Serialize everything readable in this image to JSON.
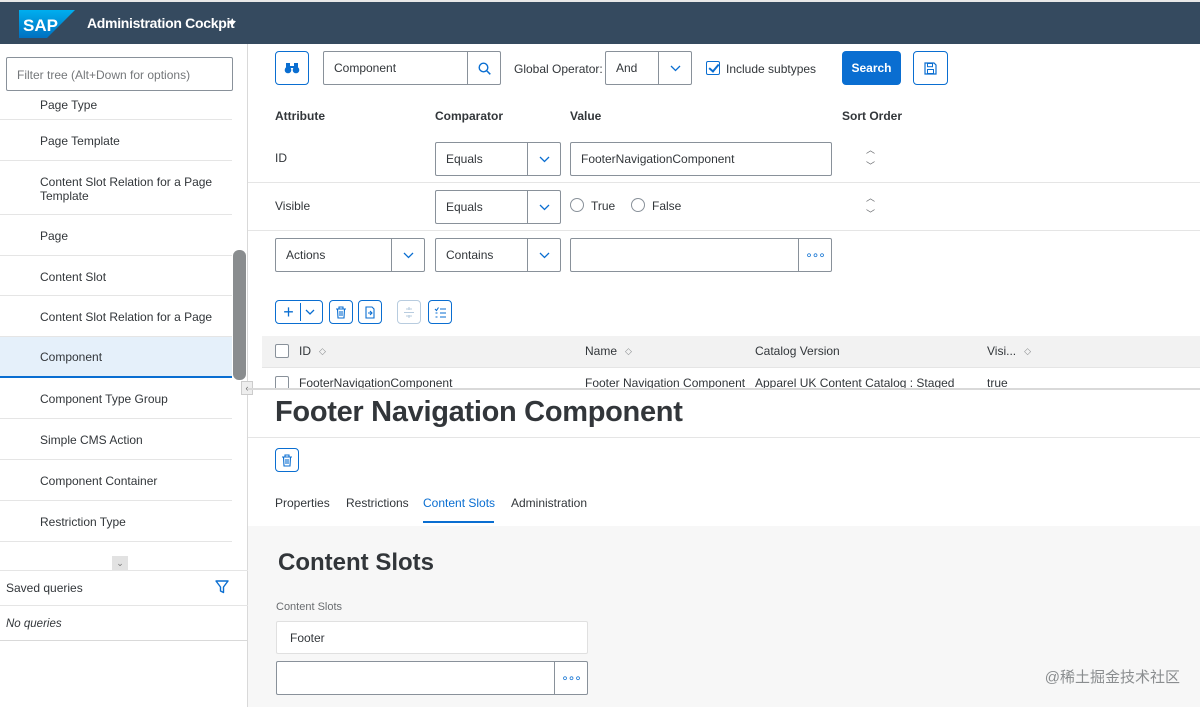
{
  "shell": {
    "logo_text": "SAP",
    "app_title": "Administration Cockpit"
  },
  "sidebar": {
    "filter_placeholder": "Filter tree (Alt+Down for options)",
    "items": [
      {
        "label": "Page Type"
      },
      {
        "label": "Page Template"
      },
      {
        "label": "Content Slot Relation for a Page Template"
      },
      {
        "label": "Page"
      },
      {
        "label": "Content Slot"
      },
      {
        "label": "Content Slot Relation for a Page"
      },
      {
        "label": "Component",
        "selected": true
      },
      {
        "label": "Component Type Group"
      },
      {
        "label": "Simple CMS Action"
      },
      {
        "label": "Component Container"
      },
      {
        "label": "Restriction Type"
      }
    ],
    "saved_queries_label": "Saved queries",
    "no_queries_label": "No queries"
  },
  "search": {
    "type_value": "Component",
    "global_operator_label": "Global Operator:",
    "global_operator_value": "And",
    "include_subtypes_label": "Include subtypes",
    "include_subtypes_checked": true,
    "search_button_label": "Search",
    "headers": {
      "attribute": "Attribute",
      "comparator": "Comparator",
      "value": "Value",
      "sort_order": "Sort Order"
    },
    "rows": {
      "id": {
        "attribute": "ID",
        "comparator": "Equals",
        "value": "FooterNavigationComponent"
      },
      "visible": {
        "attribute": "Visible",
        "comparator": "Equals",
        "true_label": "True",
        "false_label": "False"
      },
      "actions": {
        "attribute": "Actions",
        "comparator": "Contains",
        "value": ""
      }
    }
  },
  "results": {
    "columns": {
      "id": "ID",
      "name": "Name",
      "catalog_version": "Catalog Version",
      "visible": "Visi..."
    },
    "rows": [
      {
        "id": "FooterNavigationComponent",
        "name": "Footer Navigation Component",
        "catalog_version": "Apparel UK Content Catalog : Staged",
        "visible": "true"
      }
    ]
  },
  "detail": {
    "title": "Footer Navigation Component",
    "tabs": [
      {
        "label": "Properties"
      },
      {
        "label": "Restrictions"
      },
      {
        "label": "Content Slots",
        "active": true
      },
      {
        "label": "Administration"
      }
    ],
    "section_title": "Content Slots",
    "field_label": "Content Slots",
    "slots": [
      "Footer"
    ]
  },
  "watermark": "@稀土掘金技术社区",
  "colors": {
    "shell": "#354a5f",
    "accent": "#0a6ed1",
    "selected_bg": "#e5f0fa"
  }
}
